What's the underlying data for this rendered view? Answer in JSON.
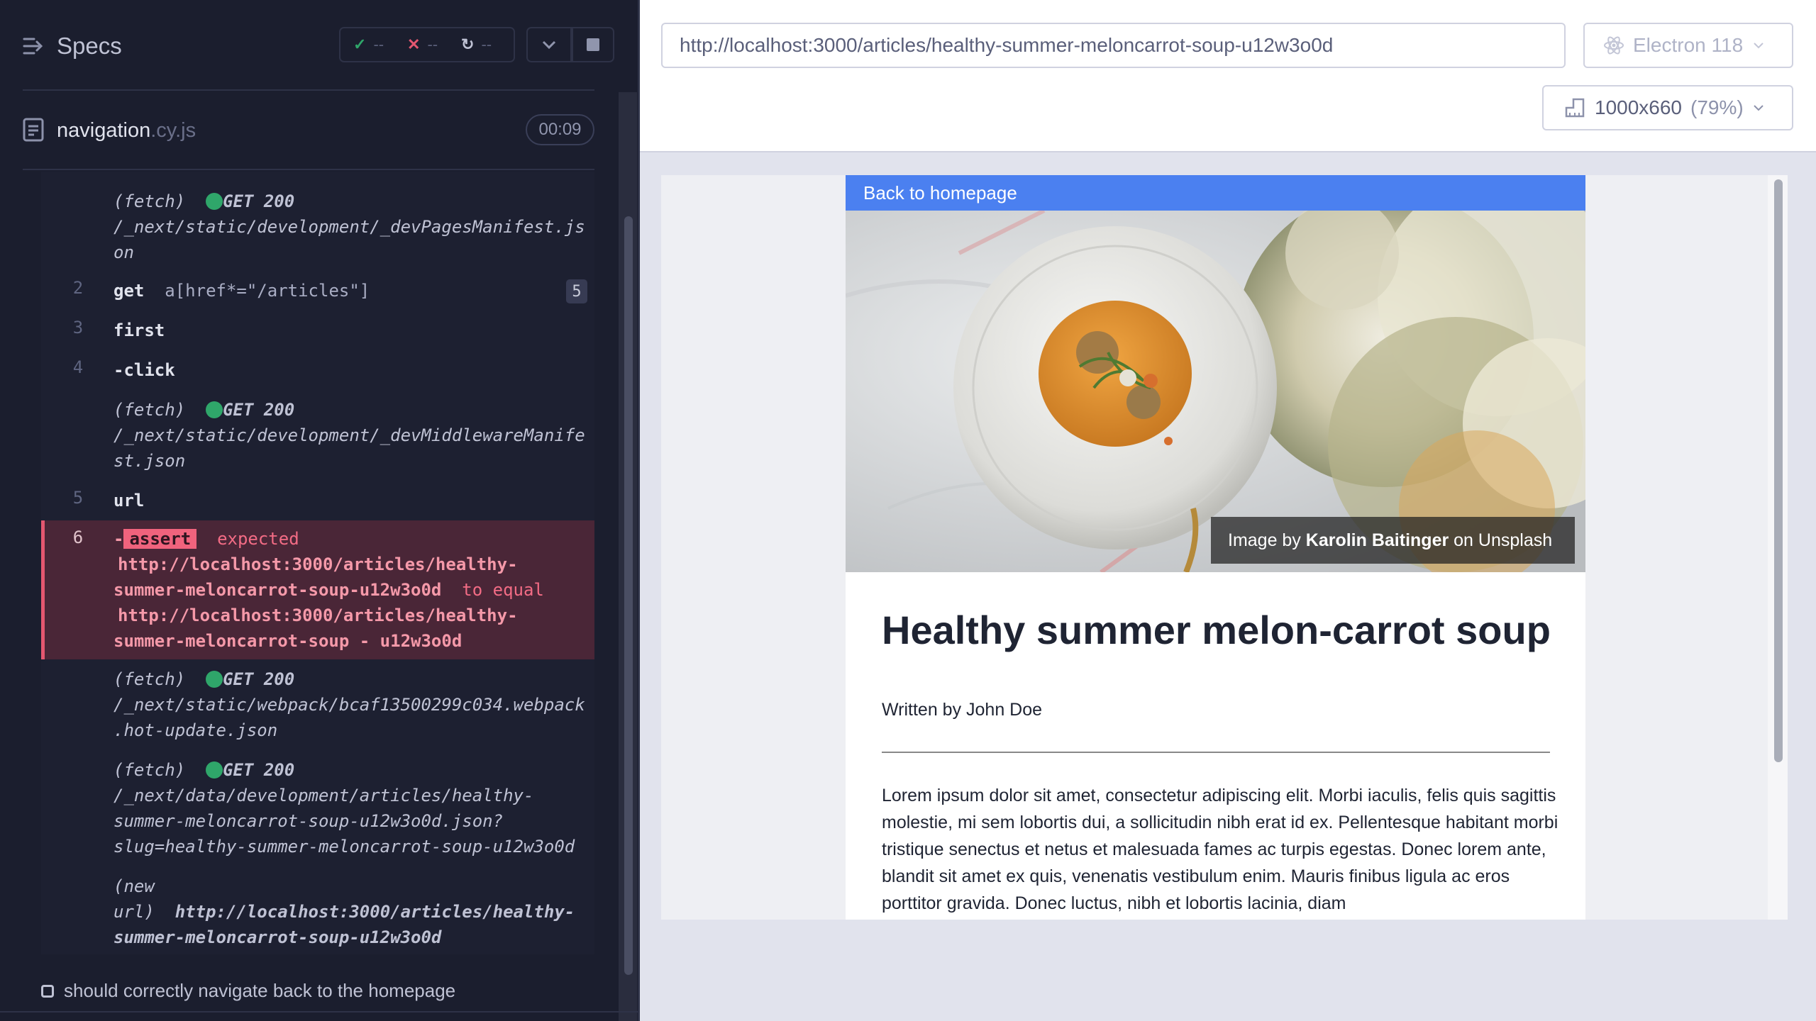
{
  "specs_header": {
    "title": "Specs",
    "passed": "--",
    "failed": "--",
    "pending": "--"
  },
  "spec": {
    "name": "navigation",
    "ext": ".cy.js",
    "duration": "00:09"
  },
  "log": {
    "fetch1": {
      "type": "(fetch)",
      "method": "GET 200",
      "url1": "/_next/static/development/_devPagesManifest.js",
      "url2": "on"
    },
    "cmd2": {
      "num": "2",
      "name": "get",
      "selector": "a[href*=\"/articles\"]",
      "count": "5"
    },
    "cmd3": {
      "num": "3",
      "name": "first"
    },
    "cmd4": {
      "num": "4",
      "name": "-click"
    },
    "fetch2": {
      "type": "(fetch)",
      "method": "GET 200",
      "url1": "/_next/static/development/_devMiddlewareManife",
      "url2": "st.json"
    },
    "cmd5": {
      "num": "5",
      "name": "url"
    },
    "cmd6": {
      "num": "6",
      "dash": "-",
      "badge": "assert",
      "expected": "expected",
      "line1": "http://localhost:3000/articles/healthy-",
      "line2": "summer-meloncarrot-soup-u12w3o0d",
      "to_equal": "to equal",
      "line3": "http://localhost:3000/articles/healthy-",
      "line4": "summer-meloncarrot-soup - u12w3o0d"
    },
    "fetch3": {
      "type": "(fetch)",
      "method": "GET 200",
      "url1": "/_next/static/webpack/bcaf13500299c034.webpack",
      "url2": ".hot-update.json"
    },
    "fetch4": {
      "type": "(fetch)",
      "method": "GET 200",
      "url1": "/_next/data/development/articles/healthy-",
      "url2": "summer-meloncarrot-soup-u12w3o0d.json?",
      "url3": "slug=healthy-summer-meloncarrot-soup-u12w3o0d"
    },
    "newurl": {
      "type1": "(new",
      "type2": "url)",
      "url1": "http://localhost:3000/articles/healthy-",
      "url2": "summer-meloncarrot-soup-u12w3o0d"
    }
  },
  "next_test": "should correctly navigate back to the homepage",
  "browser_bar": {
    "url": "http://localhost:3000/articles/healthy-summer-meloncarrot-soup-u12w3o0d",
    "browser": "Electron 118",
    "viewport": "1000x660",
    "scale": "(79%)"
  },
  "aut": {
    "back_link": "Back to homepage",
    "credit_prefix": "Image by ",
    "credit_author": "Karolin Baitinger",
    "credit_suffix": " on Unsplash",
    "title": "Healthy summer melon-carrot soup",
    "byline": "Written by John Doe",
    "body": "Lorem ipsum dolor sit amet, consectetur adipiscing elit. Morbi iaculis, felis quis sagittis molestie, mi sem lobortis dui, a sollicitudin nibh erat id ex. Pellentesque habitant morbi tristique senectus et netus et malesuada fames ac turpis egestas. Donec lorem ante, blandit sit amet ex quis, venenatis vestibulum enim. Mauris finibus ligula ac eros porttitor gravida. Donec luctus, nibh et lobortis lacinia, diam"
  },
  "colors": {
    "pass": "#2fa66a",
    "fail": "#e45770",
    "link_bar": "#4b80f0"
  }
}
